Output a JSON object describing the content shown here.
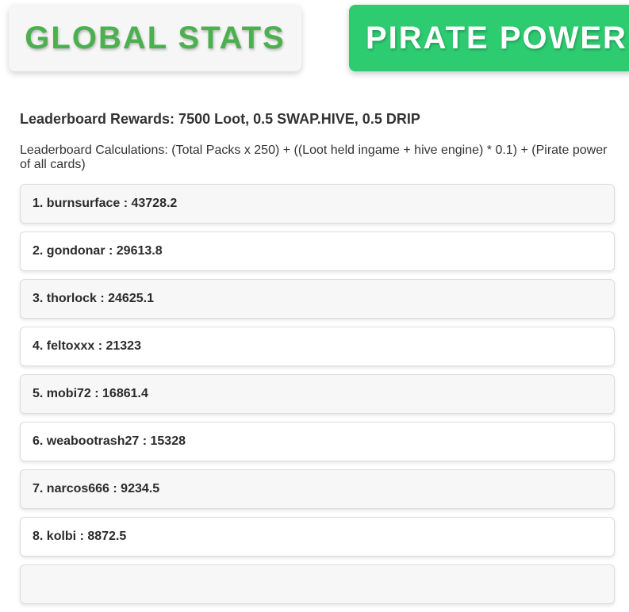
{
  "tabs": {
    "global_stats": "GLOBAL STATS",
    "pirate_power": "PIRATE POWER"
  },
  "colors": {
    "global_tab_text": "#4caf50",
    "pirate_tab_bg": "#2ecc71"
  },
  "rewards_text": "Leaderboard Rewards: 7500 Loot, 0.5 SWAP.HIVE, 0.5 DRIP",
  "calculations_text": "Leaderboard Calculations: (Total Packs x 250) + ((Loot held ingame + hive engine) * 0.1) + (Pirate power of all cards)",
  "leaderboard": [
    {
      "text": "1. burnsurface : 43728.2"
    },
    {
      "text": "2. gondonar : 29613.8"
    },
    {
      "text": "3. thorlock : 24625.1"
    },
    {
      "text": "4. feltoxxx : 21323"
    },
    {
      "text": "5. mobi72 : 16861.4"
    },
    {
      "text": "6. weabootrash27 : 15328"
    },
    {
      "text": "7. narcos666 : 9234.5"
    },
    {
      "text": "8. kolbi : 8872.5"
    },
    {
      "text": ""
    }
  ]
}
